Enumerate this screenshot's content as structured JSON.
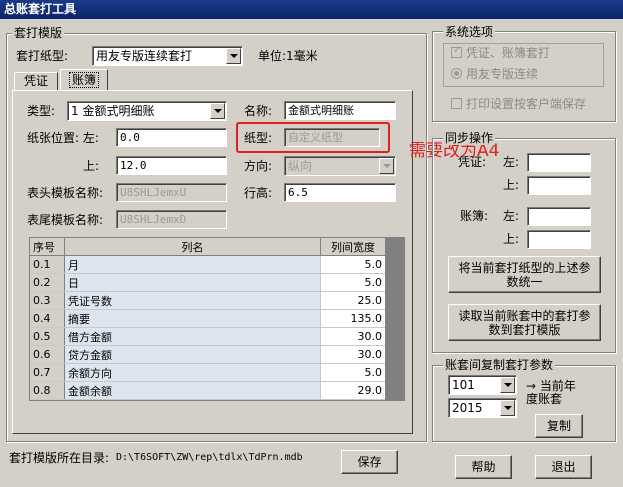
{
  "window": {
    "title": "总账套打工具"
  },
  "template_group": {
    "title": "套打模版",
    "template_label": "套打纸型:",
    "template_value": "用友专版连续套打",
    "unit_label": "单位:",
    "unit_value": "1毫米",
    "tabs": [
      {
        "label": "凭证"
      },
      {
        "label": "账簿"
      }
    ]
  },
  "ledger": {
    "type_label": "类型:",
    "type_value": "1 金额式明细账",
    "name_label": "名称:",
    "name_value": "金额式明细账",
    "paper_pos_label": "纸张位置: 左:",
    "left_value": "0.0",
    "paper_type_label": "纸型:",
    "paper_type_value": "自定义纸型",
    "top_label": "上:",
    "top_value": "12.0",
    "direction_label": "方向:",
    "direction_value": "纵向",
    "header_tpl_label": "表头模板名称:",
    "header_tpl_value": "U8SHLJemxU",
    "row_height_label": "行高:",
    "row_height_value": "6.5",
    "footer_tpl_label": "表尾模板名称:",
    "footer_tpl_value": "U8SHLJemxD"
  },
  "columns_table": {
    "headers": [
      "序号",
      "列名",
      "列间宽度"
    ],
    "rows": [
      {
        "no": "0.1",
        "name": "月",
        "width": "5.0"
      },
      {
        "no": "0.2",
        "name": "日",
        "width": "5.0"
      },
      {
        "no": "0.3",
        "name": "凭证号数",
        "width": "25.0"
      },
      {
        "no": "0.4",
        "name": "摘要",
        "width": "135.0"
      },
      {
        "no": "0.5",
        "name": "借方金额",
        "width": "30.0"
      },
      {
        "no": "0.6",
        "name": "贷方金额",
        "width": "30.0"
      },
      {
        "no": "0.7",
        "name": "余额方向",
        "width": "5.0"
      },
      {
        "no": "0.8",
        "name": "金额余额",
        "width": "29.0"
      }
    ]
  },
  "annotation": {
    "text": "需要改为A4",
    "color": "#e02020"
  },
  "path": {
    "label": "套打模版所在目录:",
    "value": "D:\\T6SOFT\\ZW\\rep\\tdlx\\TdPrn.mdb"
  },
  "buttons": {
    "save": "保存",
    "help": "帮助",
    "exit": "退出",
    "copy": "复制",
    "sync_paper": "将当前套打纸型的上述参数统一",
    "read_params": "读取当前账套中的套打参数到套打模版"
  },
  "sys_options": {
    "title": "系统选项",
    "opt_voucher_ledger": "凭证、账簿套打",
    "opt_yonyou_cont": "用友专版连续",
    "opt_print_by_client": "打印设置按客户端保存"
  },
  "sync_group": {
    "title": "同步操作",
    "voucher_label": "凭证:",
    "ledger_label": "账簿:",
    "left_label": "左:",
    "top_label": "上:"
  },
  "copy_group": {
    "title": "账套间复制套打参数",
    "account_value": "101",
    "year_value": "2015",
    "target_label": "→ 当前年度账套"
  }
}
